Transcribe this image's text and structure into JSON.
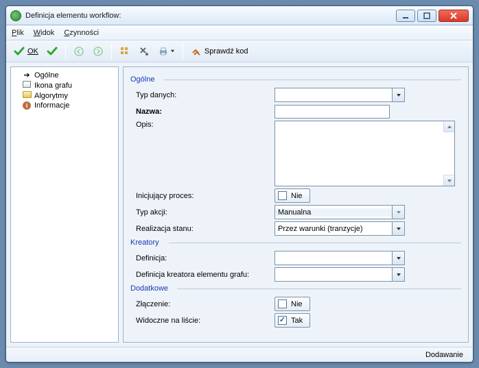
{
  "title": "Definicja elementu workflow:",
  "menu": {
    "file": "Plik",
    "view": "Widok",
    "actions": "Czynności"
  },
  "toolbar": {
    "ok": "OK",
    "check": "Sprawdź kod"
  },
  "tree": {
    "items": [
      {
        "label": "Ogólne",
        "icon": "arrow"
      },
      {
        "label": "Ikona grafu",
        "icon": "image"
      },
      {
        "label": "Algorytmy",
        "icon": "folder"
      },
      {
        "label": "Informacje",
        "icon": "info"
      }
    ]
  },
  "groups": {
    "general": "Ogólne",
    "wizards": "Kreatory",
    "extra": "Dodatkowe"
  },
  "form": {
    "typDanych": {
      "label": "Typ danych:",
      "value": ""
    },
    "nazwa": {
      "label": "Nazwa:",
      "value": ""
    },
    "opis": {
      "label": "Opis:",
      "value": ""
    },
    "inicjujacy": {
      "label": "Inicjujący proces:",
      "value": "Nie",
      "checked": false
    },
    "typAkcji": {
      "label": "Typ akcji:",
      "value": "Manualna"
    },
    "realizacja": {
      "label": "Realizacja stanu:",
      "value": "Przez warunki (tranzycje)"
    },
    "definicja": {
      "label": "Definicja:",
      "value": ""
    },
    "definicjaKreatora": {
      "label": "Definicja kreatora elementu grafu:",
      "value": ""
    },
    "zlaczenie": {
      "label": "Złączenie:",
      "value": "Nie",
      "checked": false
    },
    "widoczne": {
      "label": "Widoczne na liście:",
      "value": "Tak",
      "checked": true
    }
  },
  "status": "Dodawanie"
}
